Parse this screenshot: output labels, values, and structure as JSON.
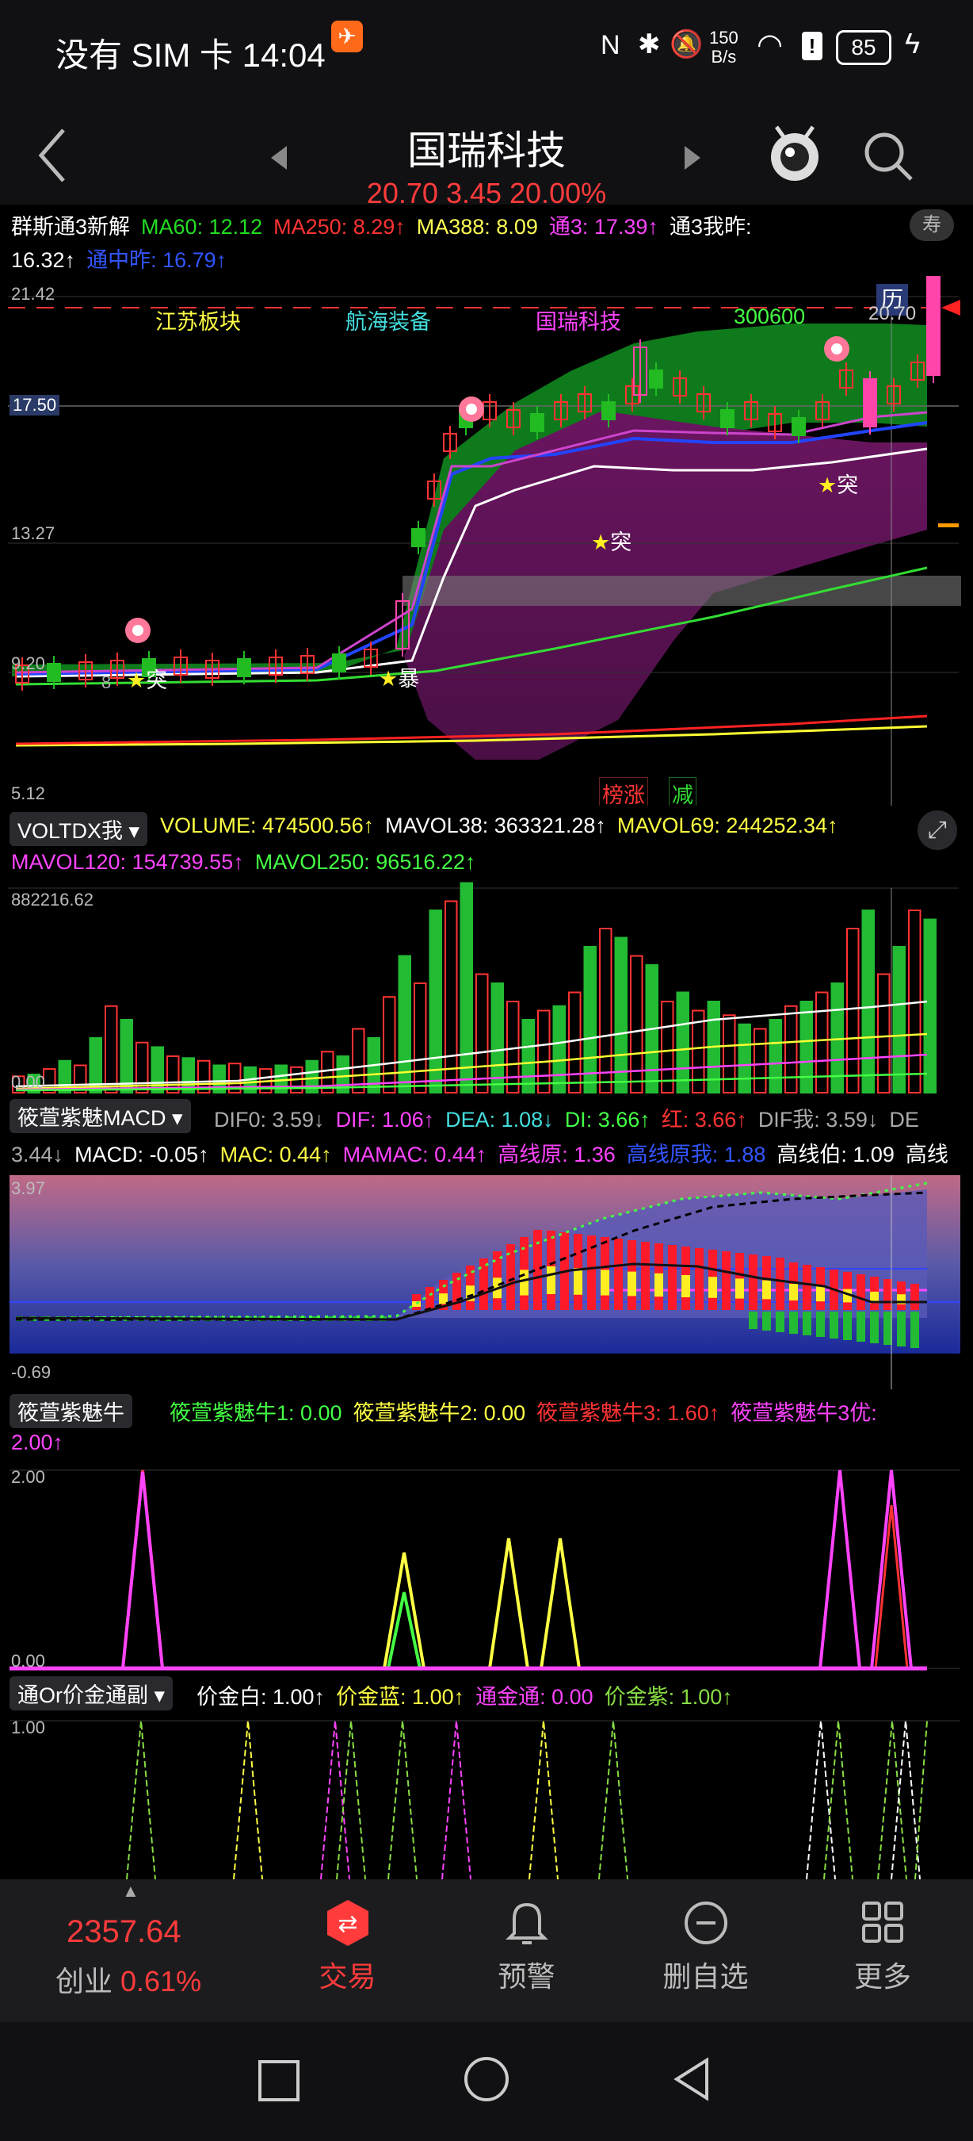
{
  "status_bar": {
    "time_text": "没有 SIM 卡 14:04",
    "net_speed_top": "150",
    "net_speed_unit": "B/s",
    "battery": "85"
  },
  "header": {
    "stock_name": "国瑞科技",
    "price_line": "20.70 3.45 20.00%"
  },
  "kline": {
    "indicator_row1": [
      {
        "text": "群斯通3新解",
        "color": "#ffffff"
      },
      {
        "text": "MA60: 12.12",
        "color": "#22dd22"
      },
      {
        "text": "MA250: 8.29↑",
        "color": "#ff3333"
      },
      {
        "text": "MA388: 8.09",
        "color": "#ffff55"
      },
      {
        "text": "通3: 17.39↑",
        "color": "#ff44ff"
      },
      {
        "text": "通3我昨:",
        "color": "#ffffff"
      }
    ],
    "indicator_row2": [
      {
        "text": "16.32↑",
        "color": "#ffffff"
      },
      {
        "text": "通中昨: 16.79↑",
        "color": "#3355ff"
      }
    ],
    "corner_badge": "寿",
    "y_labels": [
      "21.42",
      "17.50",
      "13.27",
      "9.20",
      "5.12"
    ],
    "hist_label": "历",
    "last_price": "20.70",
    "sector_labels": [
      {
        "text": "江苏板块",
        "color": "#ffff44"
      },
      {
        "text": "航海装备",
        "color": "#44dddd"
      },
      {
        "text": "国瑞科技",
        "color": "#ff44ff"
      },
      {
        "text": "300600",
        "color": "#44ff44"
      }
    ],
    "signal_tu": "突",
    "signal_bao": "暴",
    "small_value": "8",
    "bottom_tags": [
      "榜涨",
      "减"
    ]
  },
  "volume": {
    "selector": "VOLTDX我",
    "row1": [
      {
        "text": "VOLUME: 474500.56↑",
        "color": "#ffff44"
      },
      {
        "text": "MAVOL38: 363321.28↑",
        "color": "#ffffff"
      },
      {
        "text": "MAVOL69: 244252.34↑",
        "color": "#ffff44"
      }
    ],
    "row2": [
      {
        "text": "MAVOL120: 154739.55↑",
        "color": "#ff44ff"
      },
      {
        "text": "MAVOL250: 96516.22↑",
        "color": "#44ff44"
      }
    ],
    "y_top": "882216.62",
    "y_bottom": "0.00"
  },
  "macd": {
    "selector": "筱萱紫魅MACD",
    "row1": [
      {
        "text": "DIF0: 3.59↓",
        "color": "#aaaaaa"
      },
      {
        "text": "DIF: 1.06↑",
        "color": "#ff44ff"
      },
      {
        "text": "DEA: 1.08↓",
        "color": "#44dddd"
      },
      {
        "text": "DI: 3.66↑",
        "color": "#44ff44"
      },
      {
        "text": "红: 3.66↑",
        "color": "#ff3333"
      },
      {
        "text": "DIF我: 3.59↓",
        "color": "#aaaaaa"
      },
      {
        "text": "DE",
        "color": "#aaaaaa"
      }
    ],
    "row2": [
      {
        "text": "3.44↓",
        "color": "#aaaaaa"
      },
      {
        "text": "MACD: -0.05↑",
        "color": "#ffffff"
      },
      {
        "text": "MAC: 0.44↑",
        "color": "#ffff44"
      },
      {
        "text": "MAMAC: 0.44↑",
        "color": "#ff44ff"
      },
      {
        "text": "高线原: 1.36",
        "color": "#ff44ff"
      },
      {
        "text": "高线原我: 1.88",
        "color": "#3355ff"
      },
      {
        "text": "高线伯: 1.09",
        "color": "#ffffff"
      },
      {
        "text": "高线",
        "color": "#ffffff"
      }
    ],
    "y_top": "3.97",
    "y_bottom": "-0.69"
  },
  "bull": {
    "selector": "筱萱紫魅牛",
    "row1": [
      {
        "text": "筱萱紫魅牛1: 0.00",
        "color": "#44ff44"
      },
      {
        "text": "筱萱紫魅牛2: 0.00",
        "color": "#ffff44"
      },
      {
        "text": "筱萱紫魅牛3: 1.60↑",
        "color": "#ff3333"
      },
      {
        "text": "筱萱紫魅牛3优:",
        "color": "#ff44ff"
      }
    ],
    "row2": [
      {
        "text": "2.00↑",
        "color": "#ff44ff"
      }
    ],
    "y_top": "2.00",
    "y_bottom": "0.00"
  },
  "gold": {
    "selector": "通Or价金通副",
    "row1": [
      {
        "text": "价金白: 1.00↑",
        "color": "#ffffff"
      },
      {
        "text": "价金蓝: 1.00↑",
        "color": "#ffff44"
      },
      {
        "text": "通金通: 0.00",
        "color": "#ff44ff"
      },
      {
        "text": "价金紫: 1.00↑",
        "color": "#88dd44"
      }
    ],
    "y_top": "1.00"
  },
  "bottom_bar": {
    "index_value": "2357.64",
    "index_name": "创业",
    "index_change": "0.61%",
    "tabs": [
      {
        "label": "交易",
        "icon": "trade-icon"
      },
      {
        "label": "预警",
        "icon": "bell-icon"
      },
      {
        "label": "删自选",
        "icon": "remove-watchlist-icon"
      },
      {
        "label": "更多",
        "icon": "grid-icon"
      }
    ]
  }
}
